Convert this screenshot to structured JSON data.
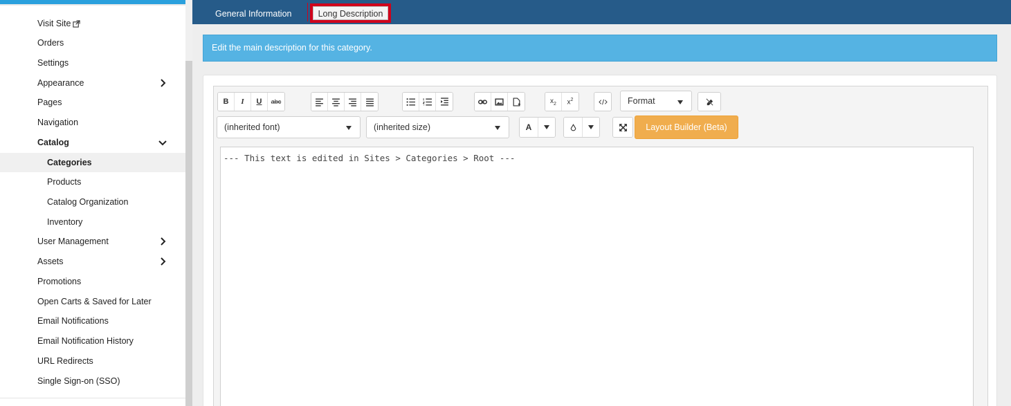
{
  "sidebar": {
    "items": [
      {
        "label": "Visit Site"
      },
      {
        "label": "Orders"
      },
      {
        "label": "Settings"
      },
      {
        "label": "Appearance"
      },
      {
        "label": "Pages"
      },
      {
        "label": "Navigation"
      },
      {
        "label": "Catalog"
      },
      {
        "label": "Categories"
      },
      {
        "label": "Products"
      },
      {
        "label": "Catalog Organization"
      },
      {
        "label": "Inventory"
      },
      {
        "label": "User Management"
      },
      {
        "label": "Assets"
      },
      {
        "label": "Promotions"
      },
      {
        "label": "Open Carts & Saved for Later"
      },
      {
        "label": "Email Notifications"
      },
      {
        "label": "Email Notification History"
      },
      {
        "label": "URL Redirects"
      },
      {
        "label": "Single Sign-on (SSO)"
      }
    ]
  },
  "tabs": {
    "general": "General Information",
    "long": "Long Description"
  },
  "alert": {
    "text": "Edit the main description for this category."
  },
  "toolbar": {
    "bold": "B",
    "italic": "I",
    "underline": "U",
    "strike": "abc",
    "format_label": "Format",
    "font_select": "(inherited font)",
    "size_select": "(inherited size)",
    "font_color": "A",
    "layout_builder": "Layout Builder (Beta)"
  },
  "editor": {
    "content": "--- This text is edited in Sites > Categories > Root ---"
  },
  "colors": {
    "header": "#265b89",
    "alert": "#55b3e3",
    "highlight": "#d0021b",
    "layout_button": "#f0ad4e"
  }
}
